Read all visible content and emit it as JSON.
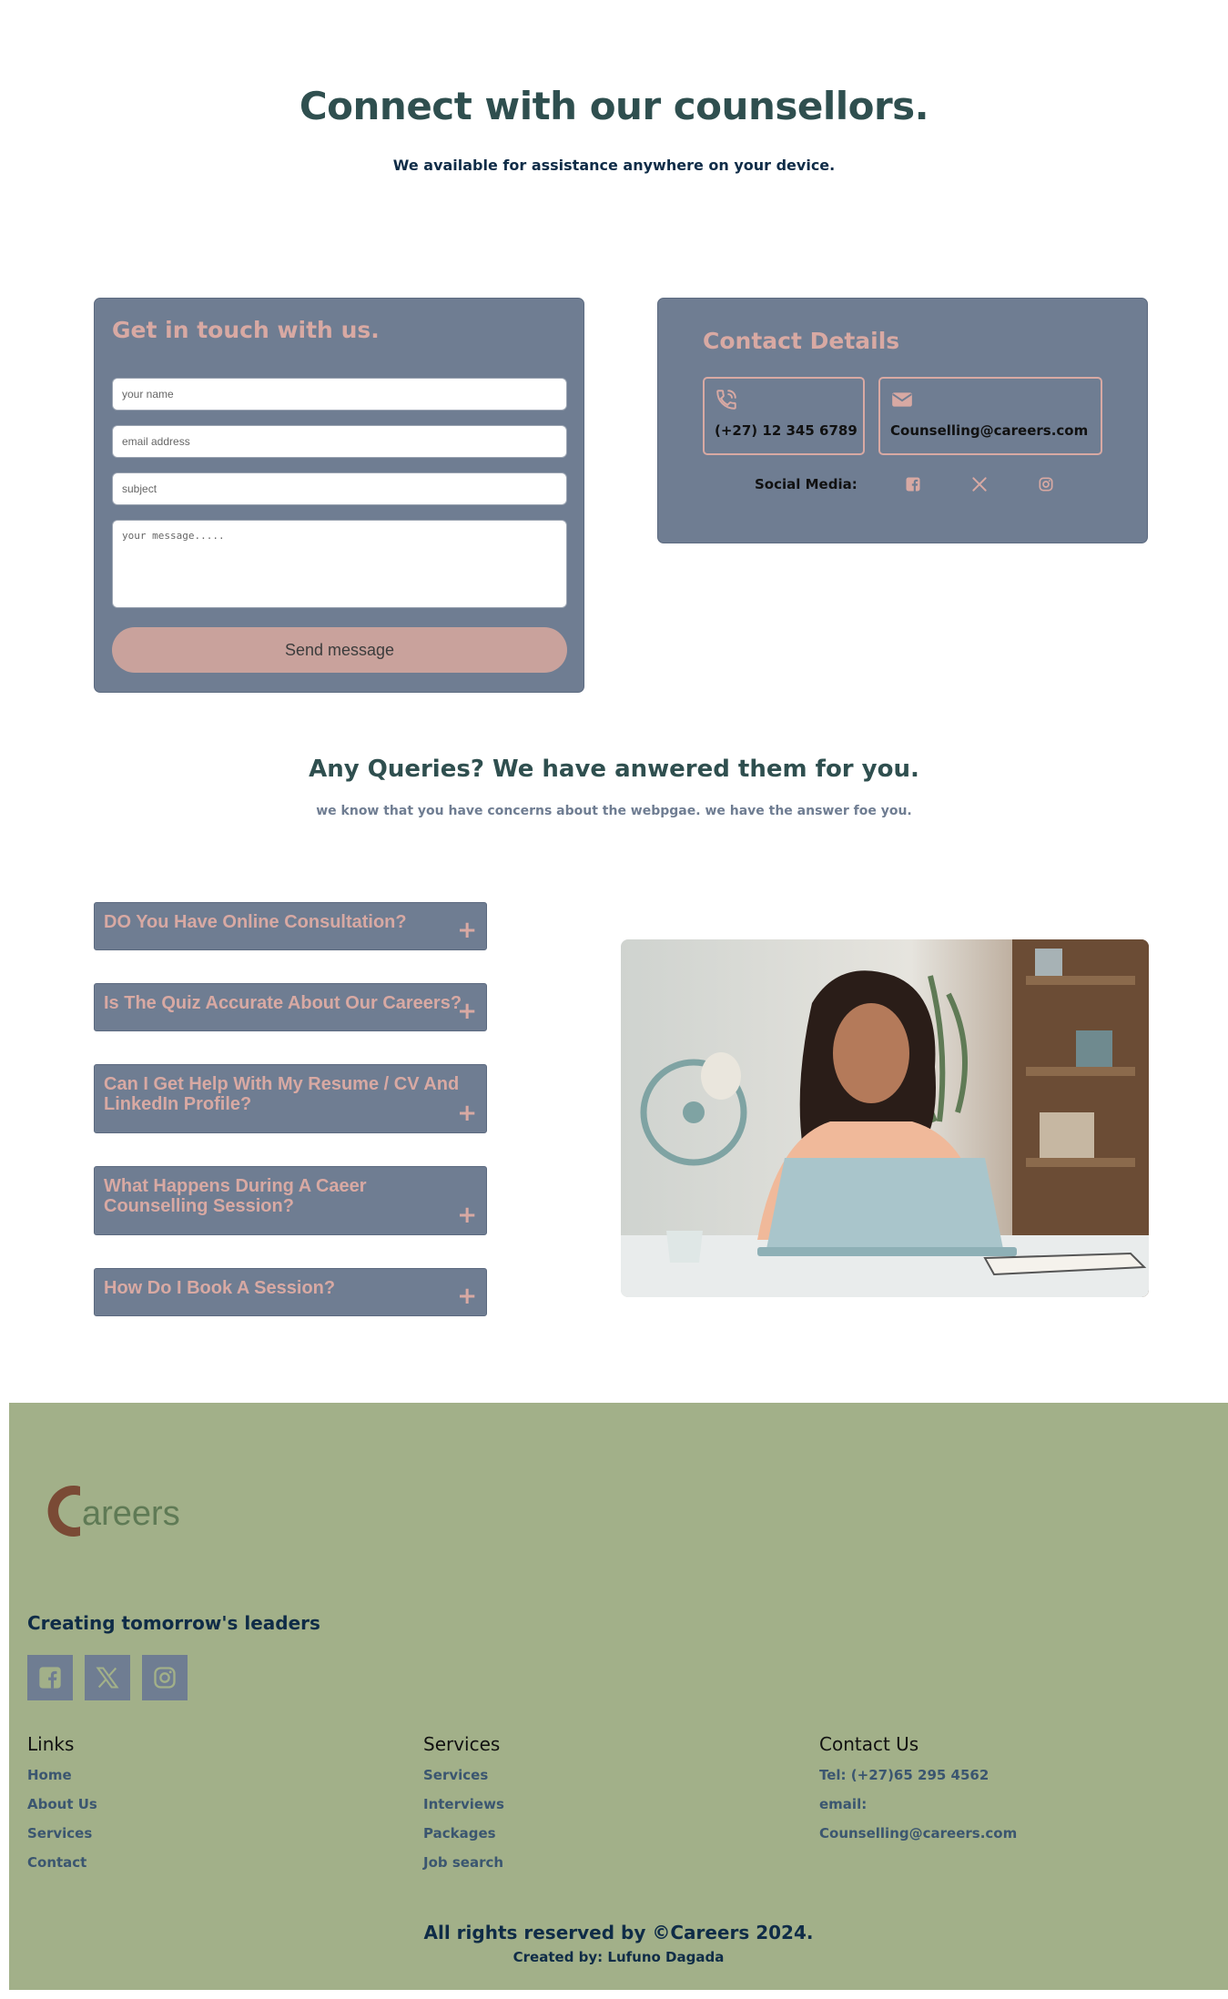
{
  "hero": {
    "title": "Connect with our counsellors.",
    "subtitle": "We available for assistance anywhere on your device."
  },
  "form": {
    "title": "Get in touch with us.",
    "name_placeholder": "your name",
    "email_placeholder": "email address",
    "subject_placeholder": "subject",
    "message_placeholder": "your message.....",
    "send_label": "Send message"
  },
  "contact": {
    "title": "Contact Details",
    "phone": "(+27) 12 345 6789",
    "email": "Counselling@careers.com",
    "social_label": "Social Media:"
  },
  "faq": {
    "title": "Any Queries? We have anwered them for you.",
    "subtitle": "we know that you have concerns about the webpgae. we have the answer foe you.",
    "items": [
      {
        "question": "DO You Have Online Consultation?",
        "icon": "+"
      },
      {
        "question": "Is The Quiz Accurate About Our Careers?",
        "icon": "+"
      },
      {
        "question": "Can I Get Help With My Resume / CV And LinkedIn Profile?",
        "icon": "+"
      },
      {
        "question": "What Happens During A Caeer Counselling Session?",
        "icon": "+"
      },
      {
        "question": "How Do I Book A Session?",
        "icon": "+"
      }
    ]
  },
  "footer": {
    "logo_text": "areers",
    "tagline": "Creating tomorrow's leaders",
    "links": {
      "heading": "Links",
      "items": [
        "Home",
        "About Us",
        "Services",
        "Contact"
      ]
    },
    "services": {
      "heading": "Services",
      "items": [
        "Services",
        "Interviews",
        "Packages",
        "Job search"
      ]
    },
    "contact": {
      "heading": "Contact Us",
      "tel": "Tel: (+27)65 295 4562",
      "email_label": "email:",
      "email": "Counselling@careers.com"
    },
    "copyright": "All rights reserved by ©Careers 2024.",
    "created_by": "Created by: Lufuno Dagada"
  },
  "colors": {
    "card_bg": "#6f7d92",
    "accent_pink": "#d8a9a3",
    "button_bg": "#c9a29c",
    "footer_bg": "#a2b089",
    "heading_dark": "#2f4f4f",
    "navy": "#0f2c47"
  },
  "icons": [
    "phone-icon",
    "envelope-icon",
    "facebook-icon",
    "x-icon",
    "instagram-icon",
    "plus-icon"
  ]
}
